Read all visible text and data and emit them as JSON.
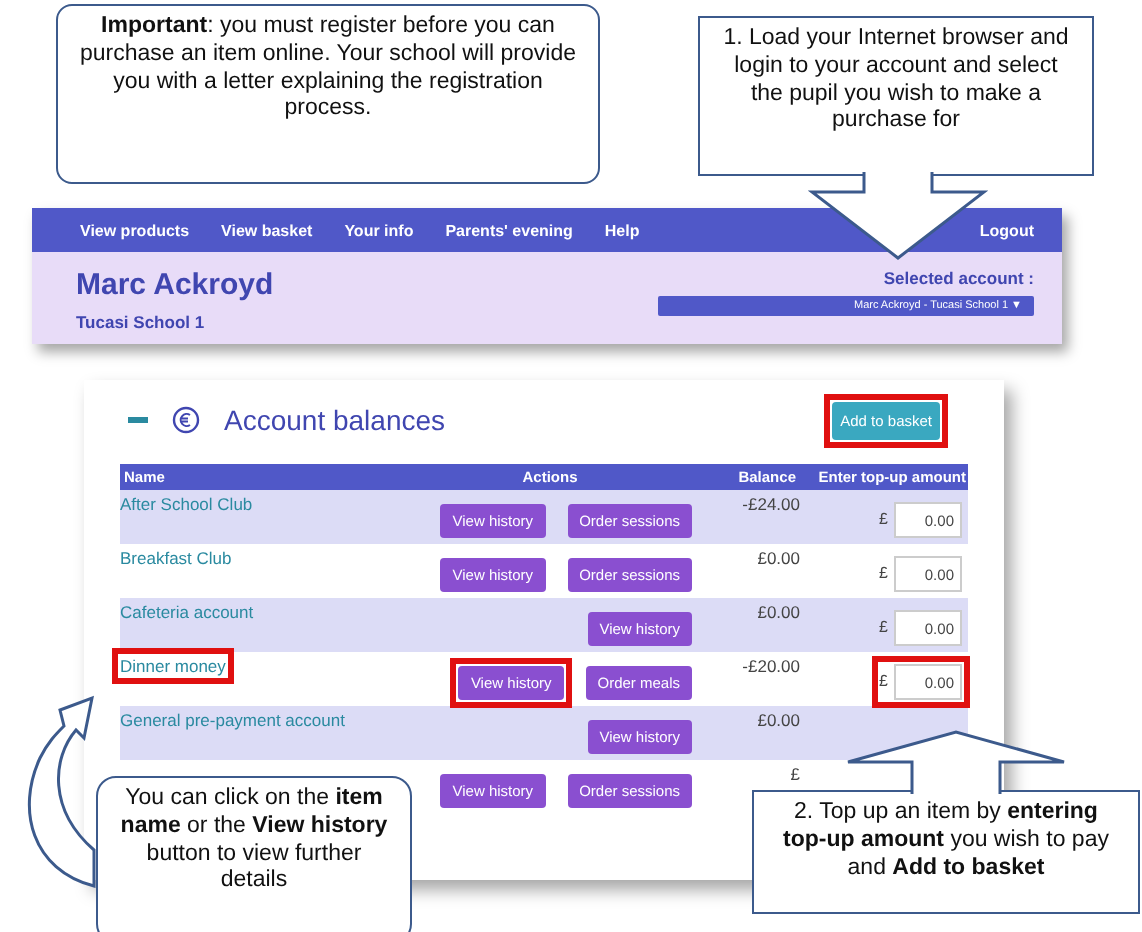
{
  "callouts": [
    {
      "kind": "important",
      "text": "**Important**: you must register before you can purchase an item online.  Your school will provide you with a letter explaining the registration process."
    },
    {
      "kind": "step1",
      "text": "1. Load your Internet browser and login to your account and select the pupil you wish to make a purchase for"
    },
    {
      "kind": "click",
      "text": "You can click on the **item name** or the **View history** button to view further details"
    },
    {
      "kind": "step2",
      "text": "2. Top up an item by **entering top-up amount** you wish to pay and **Add to basket**"
    }
  ],
  "nav": {
    "items": [
      "View products",
      "View basket",
      "Your info",
      "Parents' evening",
      "Help"
    ],
    "logout": "Logout"
  },
  "account": {
    "name": "Marc Ackroyd",
    "school": "Tucasi School 1",
    "selected_label": "Selected account :",
    "selected_value": "Marc Ackroyd - Tucasi School 1 ▼"
  },
  "balances": {
    "title": "Account balances",
    "add_button": {
      "label": "Add to basket",
      "highlighted": true
    },
    "columns": [
      "Name",
      "Actions",
      "Balance",
      "Enter top-up amount"
    ],
    "rows": [
      {
        "name": "After School Club",
        "name_highlighted": false,
        "actions": [
          {
            "label": "View history",
            "highlighted": false
          },
          {
            "label": "Order sessions",
            "highlighted": false
          }
        ],
        "balance": "-£24.00",
        "topup": {
          "currency": "£",
          "value": "0.00",
          "highlighted": false
        }
      },
      {
        "name": "Breakfast Club",
        "name_highlighted": false,
        "actions": [
          {
            "label": "View history",
            "highlighted": false
          },
          {
            "label": "Order sessions",
            "highlighted": false
          }
        ],
        "balance": "£0.00",
        "topup": {
          "currency": "£",
          "value": "0.00",
          "highlighted": false
        }
      },
      {
        "name": "Cafeteria account",
        "name_highlighted": false,
        "actions": [
          {
            "label": "View history",
            "highlighted": false
          }
        ],
        "balance": "£0.00",
        "topup": {
          "currency": "£",
          "value": "0.00",
          "highlighted": false
        }
      },
      {
        "name": "Dinner money",
        "name_highlighted": true,
        "actions": [
          {
            "label": "View history",
            "highlighted": true
          },
          {
            "label": "Order meals",
            "highlighted": false
          }
        ],
        "balance": "-£20.00",
        "topup": {
          "currency": "£",
          "value": "0.00",
          "highlighted": true
        }
      },
      {
        "name": "General pre-payment account",
        "name_highlighted": false,
        "actions": [
          {
            "label": "View history",
            "highlighted": false
          }
        ],
        "balance": "£0.00"
      },
      {
        "actions": [
          {
            "label": "View history",
            "highlighted": false
          },
          {
            "label": "Order sessions",
            "highlighted": false
          }
        ],
        "balance": "£"
      }
    ]
  }
}
